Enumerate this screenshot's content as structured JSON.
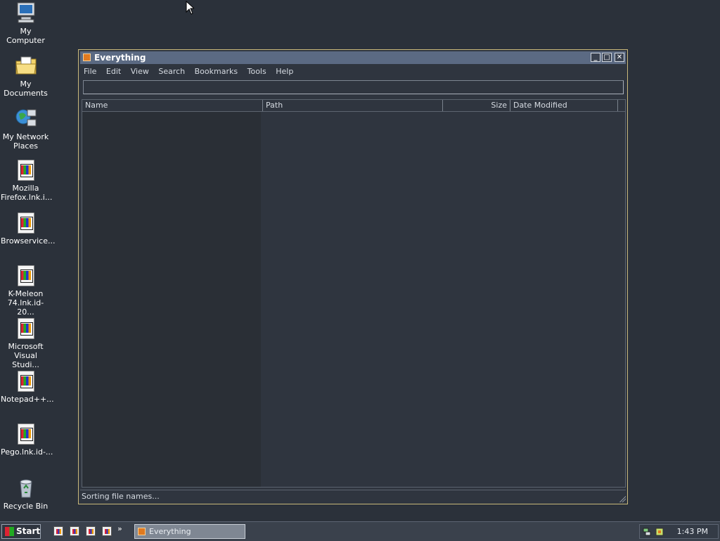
{
  "desktop": {
    "icons": [
      {
        "label_1": "My Computer",
        "label_2": "",
        "icon": "computer-icon"
      },
      {
        "label_1": "My Documents",
        "label_2": "",
        "icon": "folder-icon"
      },
      {
        "label_1": "My Network",
        "label_2": "Places",
        "icon": "network-icon"
      },
      {
        "label_1": "Mozilla",
        "label_2": "Firefox.lnk.i...",
        "icon": "shortcut-file-icon"
      },
      {
        "label_1": "Browservice...",
        "label_2": "",
        "icon": "shortcut-file-icon"
      },
      {
        "label_1": "K-Meleon",
        "label_2": "74.lnk.id-20...",
        "icon": "shortcut-file-icon"
      },
      {
        "label_1": "Microsoft",
        "label_2": "Visual Studi...",
        "icon": "shortcut-file-icon"
      },
      {
        "label_1": "Notepad++...",
        "label_2": "",
        "icon": "shortcut-file-icon"
      },
      {
        "label_1": "Pego.lnk.id-...",
        "label_2": "",
        "icon": "shortcut-file-icon"
      },
      {
        "label_1": "Recycle Bin",
        "label_2": "",
        "icon": "recycle-bin-icon"
      }
    ]
  },
  "window": {
    "title": "Everything",
    "minimize": "_",
    "maximize": "□",
    "close": "✕",
    "menu": [
      "File",
      "Edit",
      "View",
      "Search",
      "Bookmarks",
      "Tools",
      "Help"
    ],
    "search_value": "",
    "columns": {
      "name": "Name",
      "path": "Path",
      "size": "Size",
      "date_modified": "Date Modified"
    },
    "status": "Sorting file names..."
  },
  "taskbar": {
    "start_label": "Start",
    "overflow": "»",
    "task_label": "Everything",
    "clock": "1:43 PM"
  },
  "colors": {
    "desktop": "#2b313a",
    "window_border": "#c9b87a",
    "titlebar": "#5b6a83"
  }
}
